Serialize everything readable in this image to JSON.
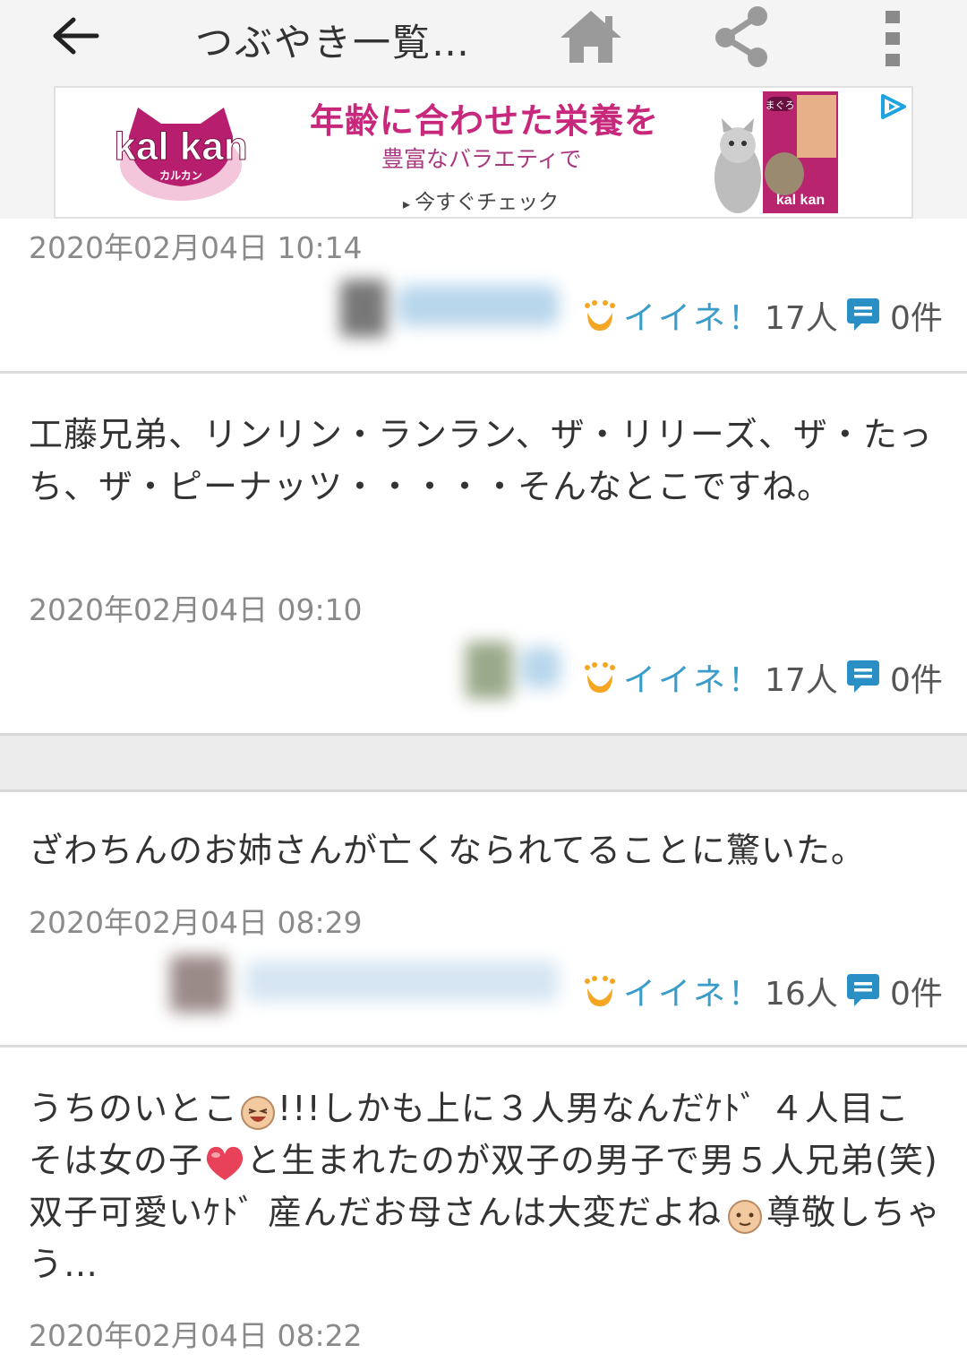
{
  "header": {
    "title": "つぶやき一覧…",
    "back_icon": "arrow-left-icon",
    "home_icon": "home-icon",
    "share_icon": "share-icon",
    "more_icon": "more-vertical-icon"
  },
  "ad": {
    "brand": "kal kan",
    "brand_sub": "カルカン",
    "headline": "年齢に合わせた栄養を",
    "subline": "豊富なバラエティで",
    "cta": "今すぐチェック",
    "pack_label": "まぐろ",
    "pack_brand": "kal kan",
    "adchoices_icon": "adchoices-icon",
    "brand_color": "#c8287c"
  },
  "posts": [
    {
      "text": "",
      "time": "2020年02月04日 10:14",
      "like_label": "イイネ！",
      "likes": "17人",
      "comments": "0件"
    },
    {
      "text": "工藤兄弟、リンリン・ランラン、ザ・リリーズ、ザ・たっち、ザ・ピーナッツ・・・・・そんなとこですね。",
      "time": "2020年02月04日 09:10",
      "like_label": "イイネ！",
      "likes": "17人",
      "comments": "0件"
    },
    {
      "text": "ざわちんのお姉さんが亡くなられてることに驚いた。",
      "time": "2020年02月04日 08:29",
      "like_label": "イイネ！",
      "likes": "16人",
      "comments": "0件"
    },
    {
      "text_parts": [
        "うちのいとこ",
        "!!!しかも上に３人男なんだｹﾄﾞ ４人目こそは女の子",
        "と生まれたのが双子の男子で男５人兄弟(笑)双子可愛いｹﾄﾞ 産んだお母さんは大変だよね",
        "尊敬しちゃう…"
      ],
      "time": "2020年02月04日 08:22"
    }
  ],
  "colors": {
    "accent": "#3a9cc8",
    "cheer_icon": "#f5a623",
    "time_text": "#8a8a8a"
  }
}
